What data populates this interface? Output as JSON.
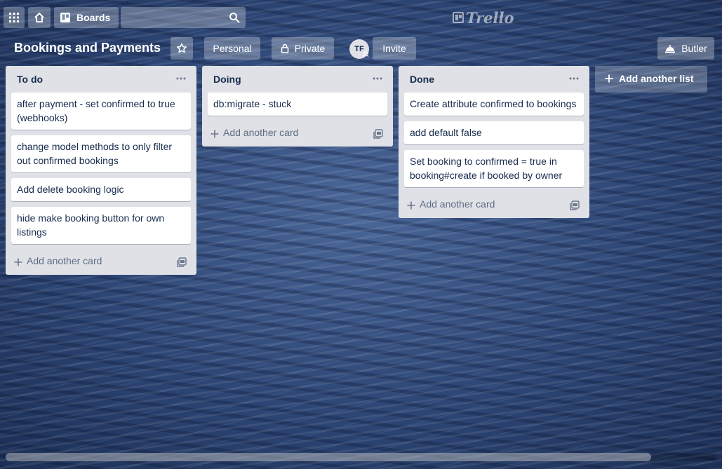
{
  "header": {
    "apps_icon": "grid-icon",
    "home_icon": "home-icon",
    "boards_label": "Boards",
    "search": {
      "value": "",
      "placeholder": ""
    },
    "logo_text": "Trello"
  },
  "board": {
    "title": "Bookings and Payments",
    "visibility_team": "Personal",
    "visibility": "Private",
    "member_initials": "TF",
    "invite_label": "Invite",
    "butler_label": "Butler"
  },
  "lists": [
    {
      "title": "To do",
      "cards": [
        "after payment - set confirmed to true (webhooks)",
        "change model methods to only filter out confirmed bookings",
        "Add delete booking logic",
        "hide make booking button for own listings"
      ],
      "add_card_label": "Add another card"
    },
    {
      "title": "Doing",
      "cards": [
        "db:migrate - stuck"
      ],
      "add_card_label": "Add another card"
    },
    {
      "title": "Done",
      "cards": [
        "Create attribute confirmed to bookings",
        "add default false",
        "Set booking to confirmed = true in booking#create if booked by owner"
      ],
      "add_card_label": "Add another card"
    }
  ],
  "add_list_label": "Add another list",
  "colors": {
    "list_bg": "#dfe1e6",
    "card_text": "#172b4d",
    "muted_text": "#5e6c84",
    "board_bg": "#2d4675"
  }
}
